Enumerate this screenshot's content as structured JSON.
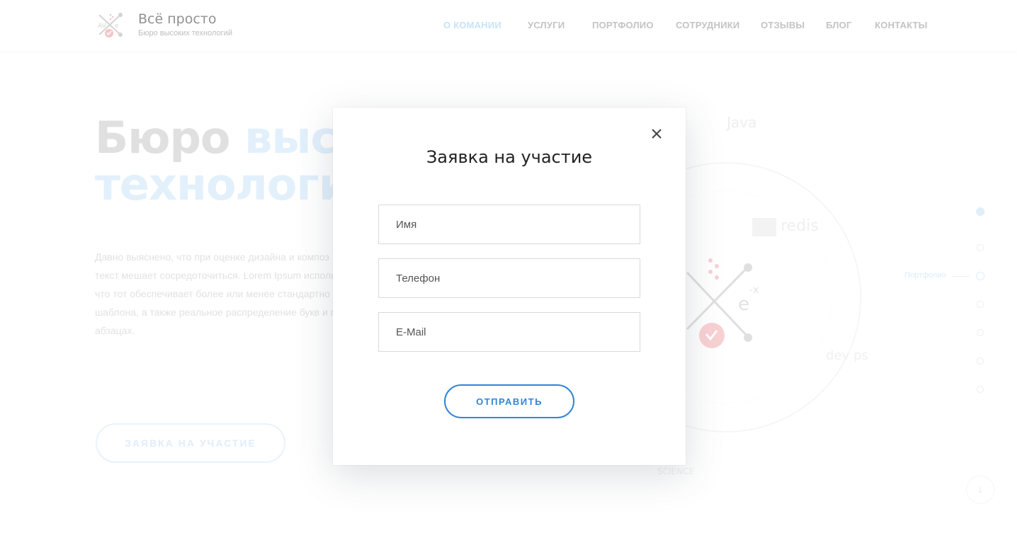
{
  "header": {
    "brand_name": "Всё просто",
    "brand_tagline": "Бюро высоких технологий",
    "nav": [
      {
        "label": "О КОМАНИИ",
        "active": true
      },
      {
        "label": "УСЛУГИ",
        "active": false
      },
      {
        "label": "ПОРТФОЛИО",
        "active": false
      },
      {
        "label": "СОТРУДНИКИ",
        "active": false
      },
      {
        "label": "ОТЗЫВЫ",
        "active": false
      },
      {
        "label": "БЛОГ",
        "active": false
      },
      {
        "label": "КОНТАКТЫ",
        "active": false
      }
    ]
  },
  "hero": {
    "title_part1": "Бюро ",
    "title_part2": "высок",
    "title_line2": "технологий",
    "text_lines": [
      "Давно выяснено, что при оценке дизайна и композ",
      "текст мешает сосредоточиться. Lorem Ipsum исполь",
      "что тот обеспечивает более или менее стандартно",
      "шаблона, а также реальное распределение букв и п",
      "абзацах."
    ],
    "cta_label": "ЗАЯВКА НА УЧАСТИЕ"
  },
  "illustration": {
    "labels": [
      "Java",
      "redis",
      "dev ps",
      "-x",
      "e",
      "SCIENCE"
    ]
  },
  "side_nav": {
    "active_label": "Портфолио"
  },
  "modal": {
    "title": "Заявка на участие",
    "fields": {
      "name_placeholder": "Имя",
      "phone_placeholder": "Телефон",
      "email_placeholder": "E-Mail"
    },
    "submit_label": "ОТПРАВИТЬ"
  },
  "colors": {
    "accent": "#2f86d9",
    "nav_active": "#a9d4f2",
    "logo_red": "#e8505b"
  }
}
